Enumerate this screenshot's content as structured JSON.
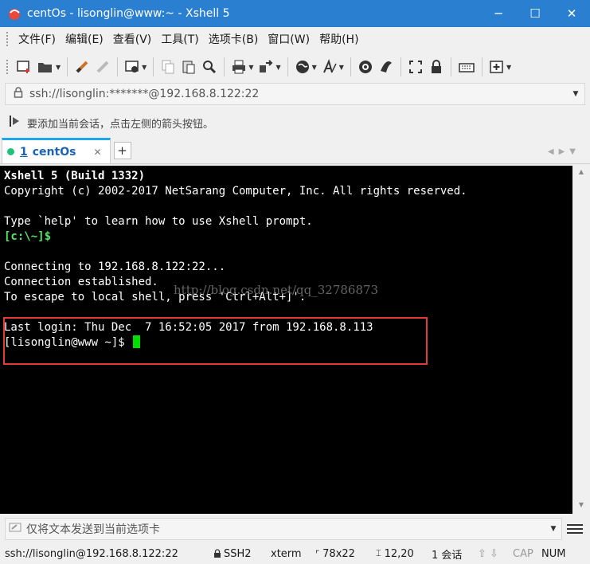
{
  "window": {
    "title": "centOs - lisonglin@www:~ - Xshell 5",
    "minimize": "─",
    "maximize": "☐",
    "close": "✕"
  },
  "menu": [
    "文件(F)",
    "编辑(E)",
    "查看(V)",
    "工具(T)",
    "选项卡(B)",
    "窗口(W)",
    "帮助(H)"
  ],
  "toolbar_icons": [
    "new-session-icon",
    "open-folder-icon",
    "reconnect-icon",
    "disconnect-icon",
    "properties-icon",
    "copy-icon",
    "paste-icon",
    "find-icon",
    "print-icon",
    "transfer-icon",
    "globe-icon",
    "font-icon",
    "xftp-icon",
    "xmanager-icon",
    "fullscreen-icon",
    "lock-icon",
    "keyboard-icon",
    "add-icon"
  ],
  "address": {
    "value": "ssh://lisonglin:*******@192.168.8.122:22"
  },
  "hint": "要添加当前会话，点击左侧的箭头按钮。",
  "tabs": [
    {
      "number": "1",
      "label": "centOs",
      "close": "✕"
    }
  ],
  "tab_add": "+",
  "terminal": {
    "lines": [
      "Xshell 5 (Build 1332)",
      "Copyright (c) 2002-2017 NetSarang Computer, Inc. All rights reserved.",
      "",
      "Type `help' to learn how to use Xshell prompt.",
      "[c:\\~]$",
      "",
      "Connecting to 192.168.8.122:22...",
      "Connection established.",
      "To escape to local shell, press 'Ctrl+Alt+]'.",
      "",
      "Last login: Thu Dec  7 16:52:05 2017 from 192.168.8.113",
      "[lisonglin@www ~]$ "
    ],
    "watermark": "http://blog.csdn.net/qq_32786873"
  },
  "send_bar": {
    "placeholder": "仅将文本发送到当前选项卡"
  },
  "status": {
    "connection": "ssh://lisonglin@192.168.8.122:22",
    "protocol": "SSH2",
    "term": "xterm",
    "size": "78x22",
    "position": "12,20",
    "sessions": "1 会话",
    "caps": "CAP",
    "num": "NUM"
  },
  "colors": {
    "titlebar": "#2b7fd1",
    "tab_accent": "#1aa7ec",
    "prompt": "#54e866",
    "cursor": "#00e000",
    "highlight": "#e53935"
  }
}
